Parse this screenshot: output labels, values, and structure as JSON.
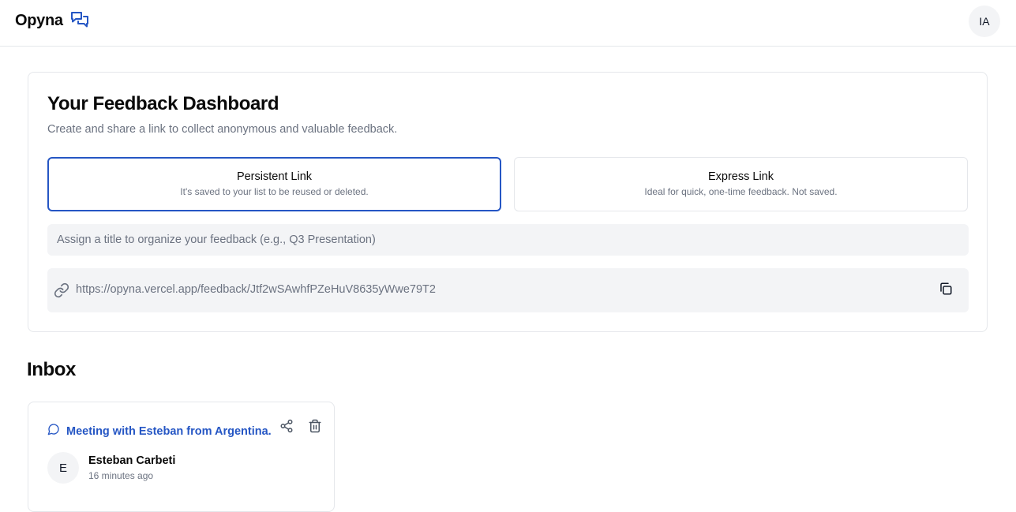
{
  "header": {
    "brand_name": "Opyna",
    "brand_icon": "chat-bubbles-icon",
    "avatar_initials": "IA"
  },
  "dashboard": {
    "title": "Your Feedback Dashboard",
    "subtitle": "Create and share a link to collect anonymous and valuable feedback.",
    "options": [
      {
        "label": "Persistent Link",
        "description": "It's saved to your list to be reused or deleted.",
        "selected": true
      },
      {
        "label": "Express Link",
        "description": "Ideal for quick, one-time feedback. Not saved.",
        "selected": false
      }
    ],
    "title_input": {
      "value": "",
      "placeholder": "Assign a title to organize your feedback (e.g., Q3 Presentation)"
    },
    "share_url": "https://opyna.vercel.app/feedback/Jtf2wSAwhfPZeHuV8635yWwe79T2"
  },
  "inbox": {
    "heading": "Inbox",
    "items": [
      {
        "title": "Meeting with Esteban from Argentina.",
        "author_initial": "E",
        "author_name": "Esteban Carbeti",
        "time_ago": "16 minutes ago"
      }
    ]
  },
  "colors": {
    "accent": "#2556c4",
    "muted_text": "#6b7280",
    "field_bg": "#f3f4f6",
    "border": "#e5e7eb"
  }
}
